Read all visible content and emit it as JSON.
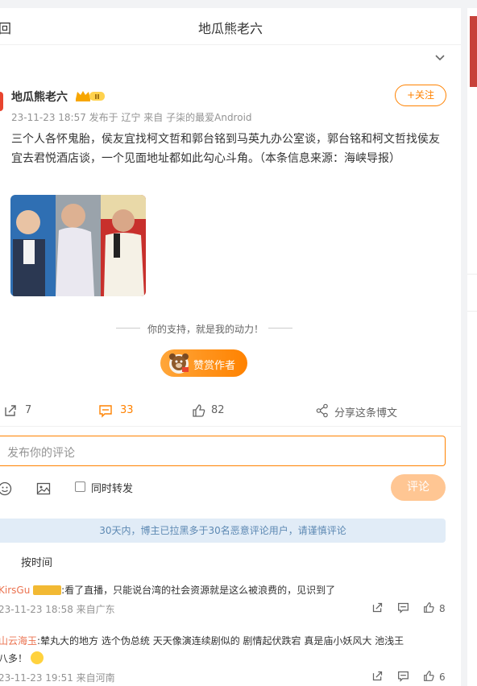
{
  "header": {
    "back_label": "回",
    "title": "地瓜熊老六"
  },
  "post": {
    "author": "地瓜熊老六",
    "badge_icon": "crown-badge-icon",
    "meta": "23-11-23 18:57  发布于 辽宁  来自 子柒的最爱Android",
    "follow_label": "+关注",
    "content": "三个人各怀鬼胎，侯友宜找柯文哲和郭台铭到马英九办公室谈，郭台铭和柯文哲找侯友宜去君悦酒店谈，一个见面地址都如此勾心斗角。（本条信息来源：海峡导报）",
    "support_text": "你的支持，就是我的动力！",
    "reward_label": "赞赏作者"
  },
  "actions": {
    "repost_count": "7",
    "comment_count": "33",
    "like_count": "82",
    "share_label": "分享这条博文"
  },
  "composer": {
    "placeholder": "发布你的评论",
    "repost_label": "同时转发",
    "submit_label": "评论"
  },
  "notice": "30天内，博主已拉黑多于30名恶意评论用户，请谨慎评论",
  "sort_label": "按时间",
  "comments": [
    {
      "nick": "KirsGu",
      "text": ":看了直播，只能说台湾的社会资源就是这么被浪费的，见识到了",
      "meta": "23-11-23 18:58 来自广东",
      "likes": "8"
    },
    {
      "nick": "山云海玉",
      "text": ":辇丸大的地方 选个伪总统 天天像演连续剧似的 剧情起伏跌宕 真是庙小妖风大 池浅王",
      "text2": "八多！",
      "meta": "23-11-23 19:51 来自河南",
      "likes": "6"
    }
  ],
  "colors": {
    "accent": "#ff8200",
    "notice_bg": "#e1ecf7",
    "nick": "#eb7350"
  }
}
